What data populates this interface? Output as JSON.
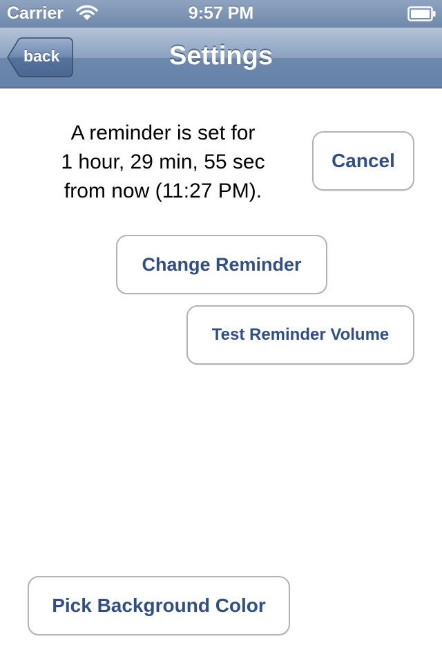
{
  "status_bar": {
    "carrier": "Carrier",
    "time": "9:57 PM",
    "wifi_icon": "wifi-icon",
    "battery_icon": "battery-icon"
  },
  "nav_bar": {
    "back_label": "back",
    "title": "Settings"
  },
  "reminder": {
    "line1": "A reminder is set for",
    "line2": "1 hour, 29 min, 55 sec",
    "line3": "from now (11:27 PM)."
  },
  "buttons": {
    "cancel": "Cancel",
    "change_reminder": "Change Reminder",
    "test_volume": "Test Reminder Volume",
    "pick_background": "Pick Background Color"
  },
  "colors": {
    "nav_bar": "#6f88aa",
    "button_text": "#324f85",
    "button_border": "#b3b3b3"
  }
}
